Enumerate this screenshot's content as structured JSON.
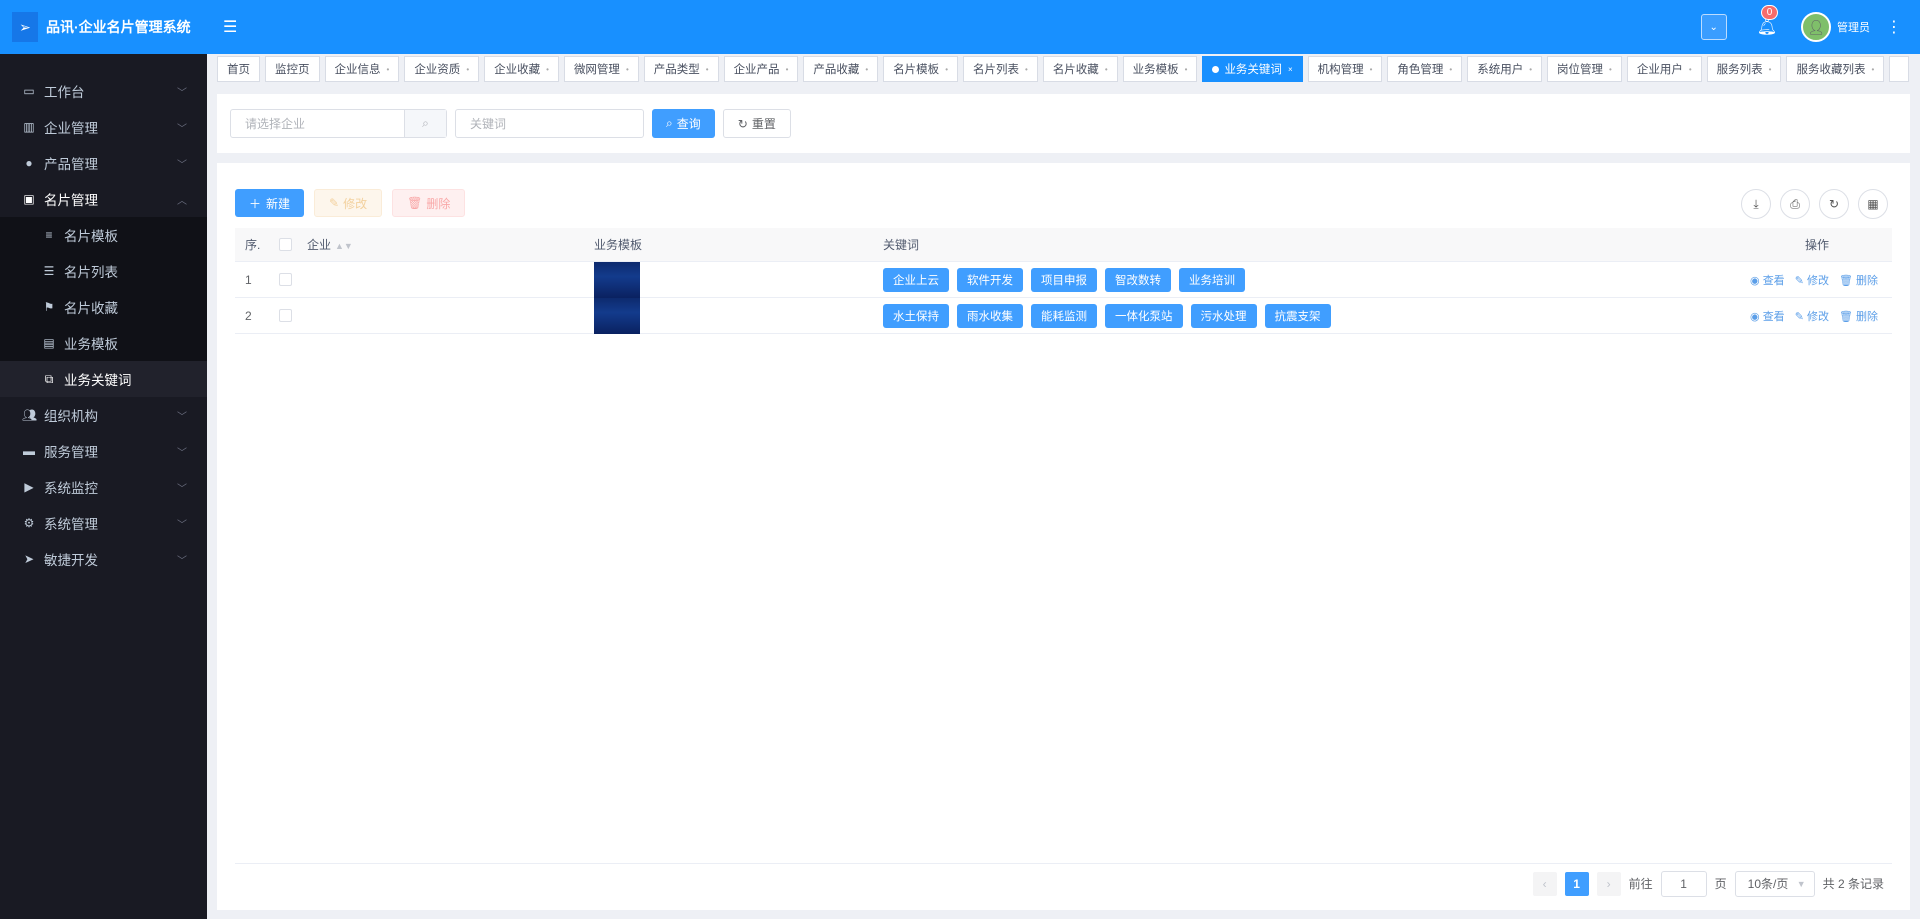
{
  "app": {
    "title": "品讯·企业名片管理系统",
    "user": "管理员",
    "notifications": "0",
    "accent": "#1890ff"
  },
  "sidebar": {
    "items": [
      {
        "label": "工作台",
        "icon": "monitor-icon"
      },
      {
        "label": "企业管理",
        "icon": "building-icon"
      },
      {
        "label": "产品管理",
        "icon": "circle-icon"
      },
      {
        "label": "名片管理",
        "icon": "id-card-icon",
        "open": true,
        "children": [
          {
            "label": "名片模板",
            "icon": "list-icon"
          },
          {
            "label": "名片列表",
            "icon": "table-icon"
          },
          {
            "label": "名片收藏",
            "icon": "flag-icon"
          },
          {
            "label": "业务模板",
            "icon": "template-icon"
          },
          {
            "label": "业务关键词",
            "icon": "tag-icon",
            "active": true
          }
        ]
      },
      {
        "label": "组织机构",
        "icon": "users-icon"
      },
      {
        "label": "服务管理",
        "icon": "briefcase-icon"
      },
      {
        "label": "系统监控",
        "icon": "play-circle-icon"
      },
      {
        "label": "系统管理",
        "icon": "gears-icon"
      },
      {
        "label": "敏捷开发",
        "icon": "send-icon"
      }
    ]
  },
  "tabs": [
    "首页",
    "监控页",
    "企业信息",
    "企业资质",
    "企业收藏",
    "微网管理",
    "产品类型",
    "企业产品",
    "产品收藏",
    "名片模板",
    "名片列表",
    "名片收藏",
    "业务模板",
    "业务关键词",
    "机构管理",
    "角色管理",
    "系统用户",
    "岗位管理",
    "企业用户",
    "服务列表",
    "服务收藏列表",
    ""
  ],
  "active_tab": "业务关键词",
  "search": {
    "company_placeholder": "请选择企业",
    "keyword_placeholder": "关键词",
    "query": "查询",
    "reset": "重置"
  },
  "toolbar": {
    "new": "新建",
    "edit": "修改",
    "delete": "删除"
  },
  "table": {
    "headers": {
      "index": "序.",
      "company": "企业",
      "template": "业务模板",
      "keywords": "关键词",
      "actions": "操作"
    },
    "rows": [
      {
        "index": "1",
        "company": "",
        "keywords": [
          "企业上云",
          "软件开发",
          "项目申报",
          "智改数转",
          "业务培训"
        ]
      },
      {
        "index": "2",
        "company": "",
        "keywords": [
          "水土保持",
          "雨水收集",
          "能耗监测",
          "一体化泵站",
          "污水处理",
          "抗震支架"
        ]
      }
    ],
    "row_actions": {
      "view": "查看",
      "edit": "修改",
      "delete": "删除"
    }
  },
  "pagination": {
    "current": "1",
    "goto_label": "前往",
    "goto_value": "1",
    "page_suffix": "页",
    "page_size": "10条/页",
    "total": "共 2 条记录"
  }
}
